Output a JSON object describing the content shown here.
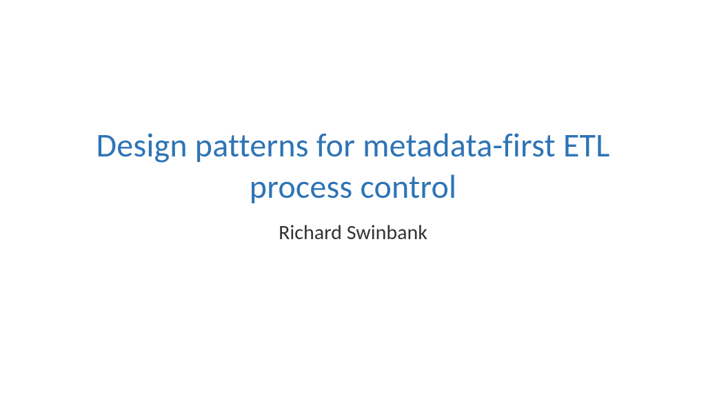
{
  "slide": {
    "title": "Design patterns for metadata-first ETL process control",
    "author": "Richard Swinbank"
  }
}
